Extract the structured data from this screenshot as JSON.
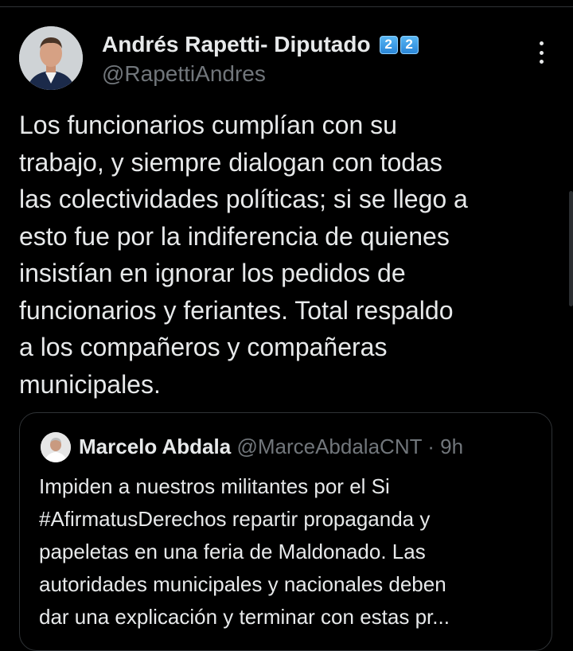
{
  "tweet": {
    "author_name": "Andrés Rapetti- Diputado",
    "badges": [
      "2",
      "2"
    ],
    "handle": "@RapettiAndres",
    "text_lines": [
      "Los funcionarios cumplían con su",
      "trabajo, y siempre dialogan con todas",
      "las colectividades políticas; si se llego a",
      "esto fue por la indiferencia de quienes",
      "insistían en ignorar los pedidos de",
      "funcionarios y feriantes. Total respaldo",
      "a los compañeros y compañeras",
      "municipales."
    ]
  },
  "quoted_tweet": {
    "author_name": "Marcelo Abdala",
    "handle": "@MarceAbdalaCNT",
    "separator": "·",
    "time": "9h",
    "text_lines": [
      "Impiden a nuestros militantes por el Si",
      "#AfirmatusDerechos repartir propaganda y",
      "papeletas en una feria de Maldonado. Las",
      "autoridades municipales y nacionales deben",
      "dar una explicación y terminar con estas pr..."
    ]
  },
  "icons": {
    "more": "more-vertical-icon",
    "badge": "keycap-digit-two-emoji"
  },
  "colors": {
    "background": "#000000",
    "primary_text": "#e7e9ea",
    "secondary_text": "#71767b",
    "border": "#2f3336"
  }
}
